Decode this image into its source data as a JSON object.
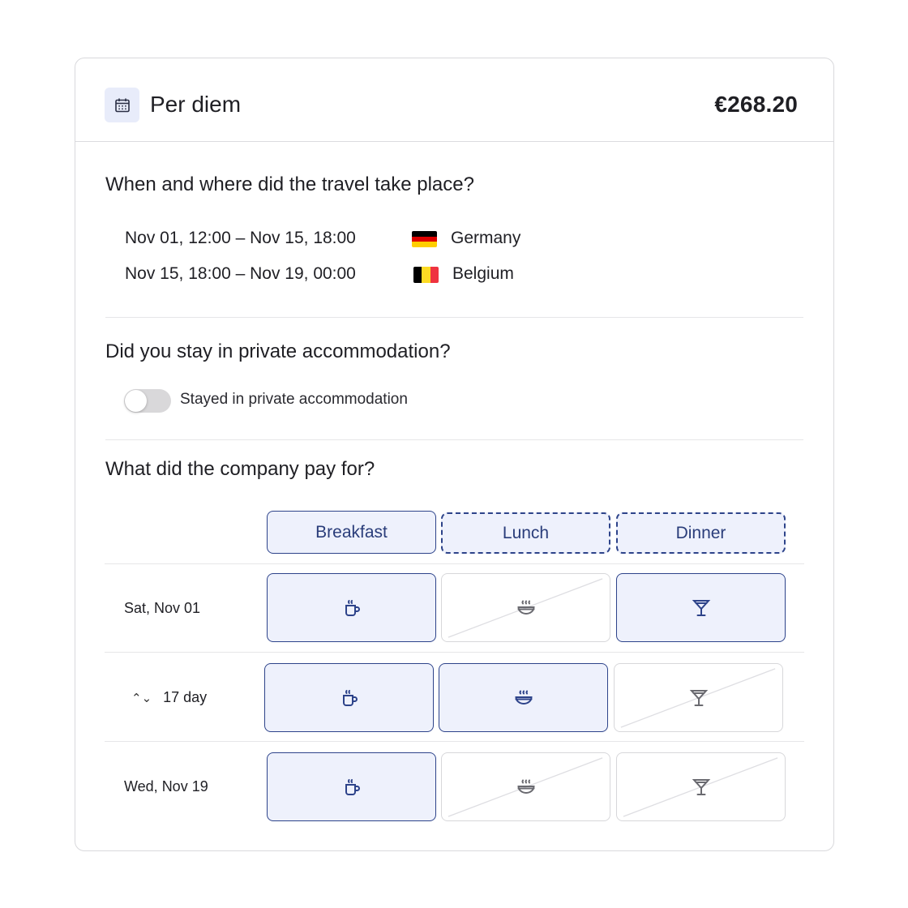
{
  "header": {
    "icon": "calendar-icon",
    "title": "Per diem",
    "amount": "€268.20"
  },
  "travel": {
    "question": "When and where did the travel take place?",
    "rows": [
      {
        "dates": "Nov 01, 12:00 – Nov 15, 18:00",
        "country": "Germany",
        "flag": [
          "#000000",
          "#dd0000",
          "#ffce00"
        ]
      },
      {
        "dates": "Nov 15, 18:00 – Nov 19, 00:00",
        "country": "Belgium",
        "flag": [
          "#000000",
          "#fdda24",
          "#ef3340"
        ]
      }
    ]
  },
  "accommodation": {
    "question": "Did you stay in private accommodation?",
    "toggle_label": "Stayed in private accommodation",
    "toggle_on": false
  },
  "meals": {
    "question": "What did the company pay for?",
    "headers": [
      {
        "label": "Breakfast",
        "style": "solid"
      },
      {
        "label": "Lunch",
        "style": "dashed"
      },
      {
        "label": "Dinner",
        "style": "dashed"
      }
    ],
    "rows": [
      {
        "label": "Sat, Nov 01",
        "chevron": false,
        "cells": [
          true,
          false,
          true
        ]
      },
      {
        "label": "17 day",
        "chevron": true,
        "cells": [
          true,
          true,
          false
        ]
      },
      {
        "label": "Wed, Nov 19",
        "chevron": false,
        "cells": [
          true,
          false,
          false
        ]
      }
    ],
    "icons": [
      "coffee-cup-icon",
      "soup-bowl-icon",
      "cocktail-glass-icon"
    ]
  },
  "colors": {
    "accent": "#2d438a",
    "accent_bg": "#eef1fc",
    "toggle_off": "#d9d8da"
  }
}
